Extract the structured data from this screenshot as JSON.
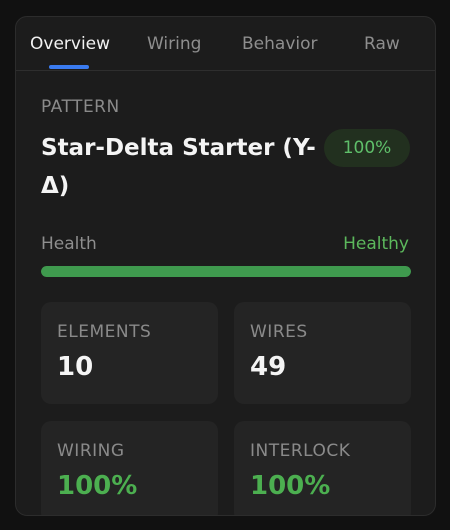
{
  "tabs": [
    {
      "label": "Overview",
      "active": true
    },
    {
      "label": "Wiring",
      "active": false
    },
    {
      "label": "Behavior",
      "active": false
    },
    {
      "label": "Raw",
      "active": false
    }
  ],
  "pattern": {
    "label": "PATTERN",
    "title": "Star-Delta Starter (Y-Δ)",
    "score": "100%"
  },
  "health": {
    "label": "Health",
    "status": "Healthy",
    "level_percent": 100
  },
  "stats": [
    {
      "label": "ELEMENTS",
      "value": "10"
    },
    {
      "label": "WIRES",
      "value": "49"
    },
    {
      "label": "WIRING",
      "value": "100%"
    },
    {
      "label": "INTERLOCK",
      "value": "100%"
    }
  ],
  "colors": {
    "accent": "#3a7bf0",
    "healthy": "#5cb85c",
    "panel_bg": "#1c1c1c",
    "card_bg": "#242424"
  }
}
